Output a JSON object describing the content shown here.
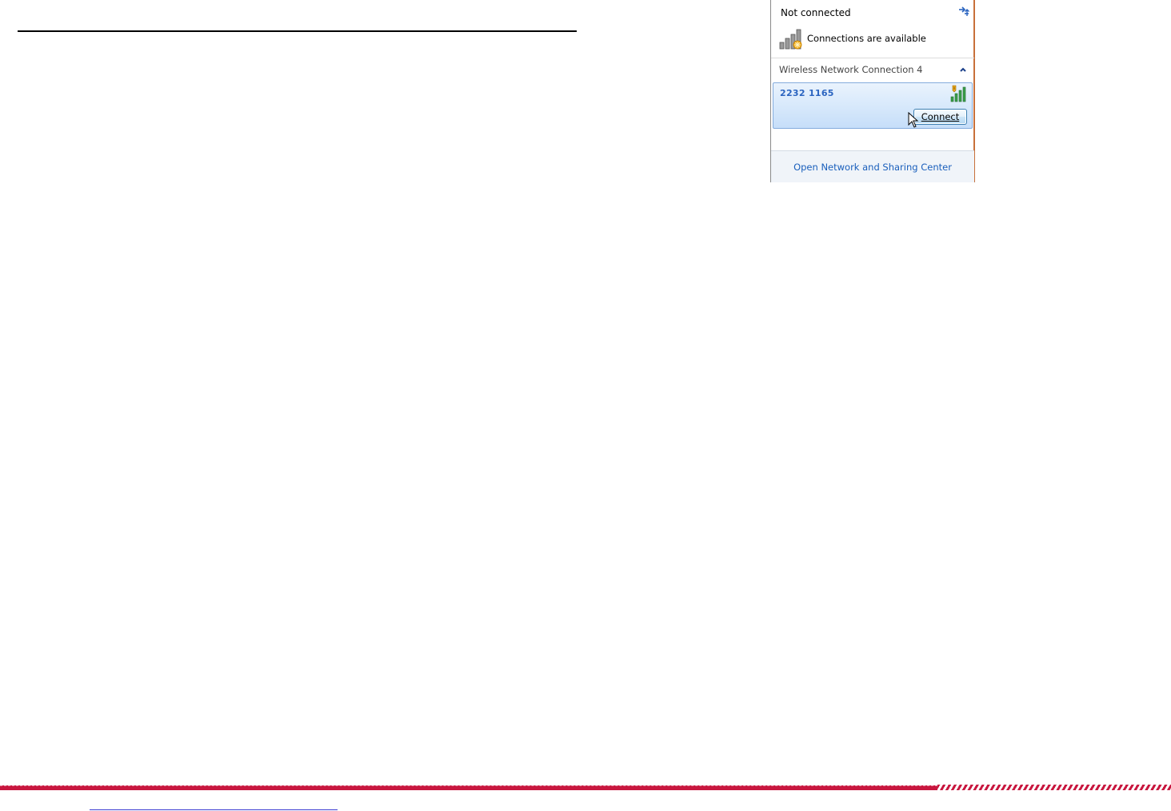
{
  "flyout": {
    "status_title": "Not connected",
    "refresh_icon": "refresh-arrows-icon",
    "availability_icon": "signal-bars-warning-icon",
    "availability_text": "Connections are available",
    "group": {
      "label": "Wireless Network Connection 4",
      "collapse_icon": "chevron-up-icon"
    },
    "networks": [
      {
        "name": "2232 1165",
        "signal_icon": "signal-strength-unsecured-icon",
        "connect_label": "Connect"
      }
    ],
    "footer_link": "Open Network and Sharing Center"
  },
  "colors": {
    "accent_blue": "#1a5fbc",
    "network_name": "#2a64c0",
    "brand_red": "#c8173f"
  }
}
